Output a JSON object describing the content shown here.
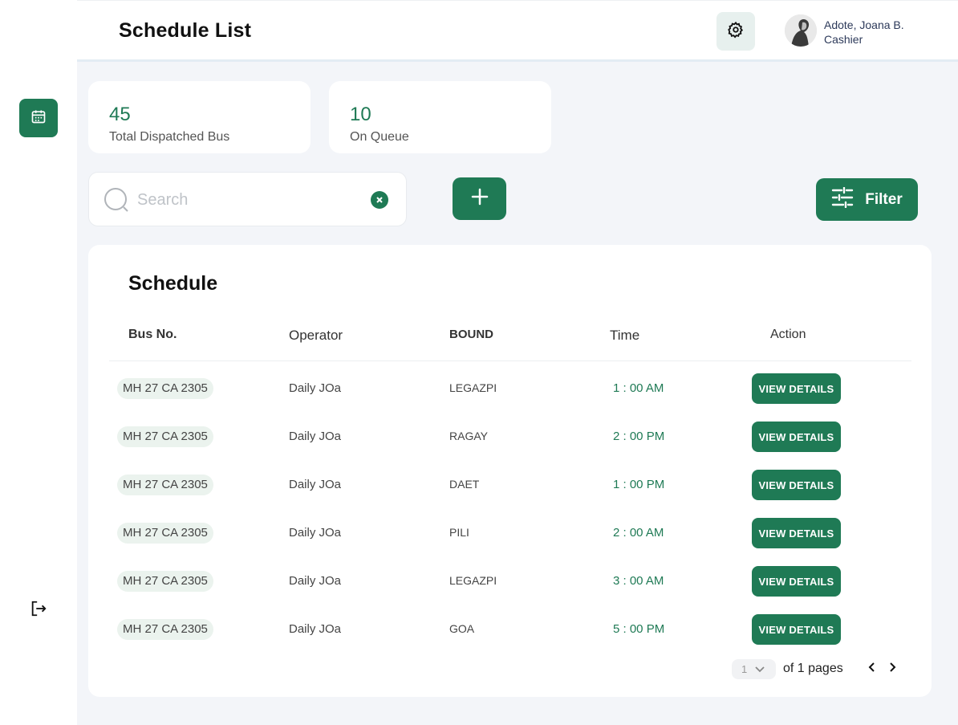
{
  "header": {
    "title": "Schedule List",
    "user": {
      "name": "Adote, Joana B.",
      "role": "Cashier"
    }
  },
  "colors": {
    "accent": "#1f7a55",
    "background": "#f3f5f9",
    "chip": "#ebf3ee"
  },
  "stats": [
    {
      "value": "45",
      "label": "Total Dispatched Bus"
    },
    {
      "value": "10",
      "label": "On Queue"
    }
  ],
  "search": {
    "placeholder": "Search",
    "value": ""
  },
  "toolbar": {
    "filter_label": "Filter"
  },
  "table": {
    "title": "Schedule",
    "columns": [
      "Bus No.",
      "Operator",
      "BOUND",
      "Time",
      "Action"
    ],
    "rows": [
      {
        "bus": "MH 27 CA 2305",
        "operator": "Daily JOa",
        "bound": "LEGAZPI",
        "time": "1 : 00 AM",
        "action": "VIEW DETAILS"
      },
      {
        "bus": "MH 27 CA 2305",
        "operator": "Daily JOa",
        "bound": "RAGAY",
        "time": "2 : 00 PM",
        "action": "VIEW DETAILS"
      },
      {
        "bus": "MH 27 CA 2305",
        "operator": "Daily JOa",
        "bound": "DAET",
        "time": "1 : 00 PM",
        "action": "VIEW DETAILS"
      },
      {
        "bus": "MH 27 CA 2305",
        "operator": "Daily JOa",
        "bound": "PILI",
        "time": "2 : 00 AM",
        "action": "VIEW DETAILS"
      },
      {
        "bus": "MH 27 CA 2305",
        "operator": "Daily JOa",
        "bound": "LEGAZPI",
        "time": "3 : 00 AM",
        "action": "VIEW DETAILS"
      },
      {
        "bus": "MH 27 CA 2305",
        "operator": "Daily JOa",
        "bound": "GOA",
        "time": "5 : 00 PM",
        "action": "VIEW DETAILS"
      }
    ]
  },
  "pagination": {
    "current_page": "1",
    "of_text": "of 1 pages"
  },
  "icons": {
    "settings": "gear-icon",
    "calendar": "calendar-icon",
    "logout": "logout-icon",
    "search": "search-icon",
    "clear": "close-icon",
    "add": "plus-icon",
    "filter": "sliders-icon",
    "prev": "chevron-left-icon",
    "next": "chevron-right-icon"
  }
}
